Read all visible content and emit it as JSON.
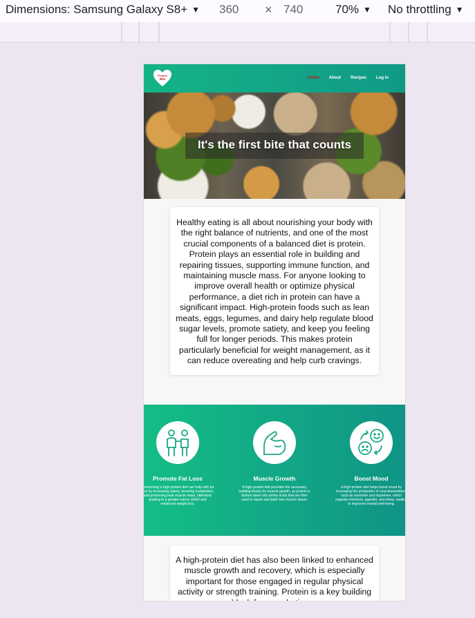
{
  "devtools": {
    "device_label": "Dimensions: Samsung Galaxy S8+",
    "width": "360",
    "times": "×",
    "height": "740",
    "zoom": "70%",
    "throttle": "No throttling"
  },
  "site": {
    "logo_text_1": "Protein",
    "logo_text_2": "Bite",
    "nav": [
      "Home",
      "About",
      "Recipes",
      "Log In"
    ],
    "hero_title": "It's the first bite that counts",
    "intro": "Healthy eating is all about nourishing your body with the right balance of nutrients, and one of the most crucial components of a balanced diet is protein. Protein plays an essential role in building and repairing tissues, supporting immune function, and maintaining muscle mass. For anyone looking to improve overall health or optimize physical performance, a diet rich in protein can have a significant impact. High-protein foods such as lean meats, eggs, legumes, and dairy help regulate blood sugar levels, promote satiety, and keep you feeling full for longer periods. This makes protein particularly beneficial for weight management, as it can reduce overeating and help curb cravings.",
    "benefits": [
      {
        "icon": "fat-loss-icon",
        "title": "Promote Fat Loss",
        "text": "Consuming a high-protein diet can help with fat loss by increasing satiety, boosting metabolism, and preserving lean muscle mass, ultimately leading to a greater caloric deficit and enhanced weight loss."
      },
      {
        "icon": "muscle-icon",
        "title": "Muscle Growth",
        "text": "A high-protein diet provides the necessary building blocks for muscle growth, as protein is broken down into amino acids that are then used to repair and build new muscle tissue."
      },
      {
        "icon": "mood-icon",
        "title": "Boost Mood",
        "text": "A high-protein diet helps boost mood by increasing the production of neurotransmitters such as serotonin and dopamine, which regulate emotions, appetite, and sleep, leading to improved mental well-being."
      }
    ],
    "second_card": "A high-protein diet has also been linked to enhanced muscle growth and recovery, which is especially important for those engaged in regular physical activity or strength training. Protein is a key building block for muscle tissue"
  },
  "colors": {
    "accent": "#15b387",
    "nav_active": "#c21a1a"
  }
}
